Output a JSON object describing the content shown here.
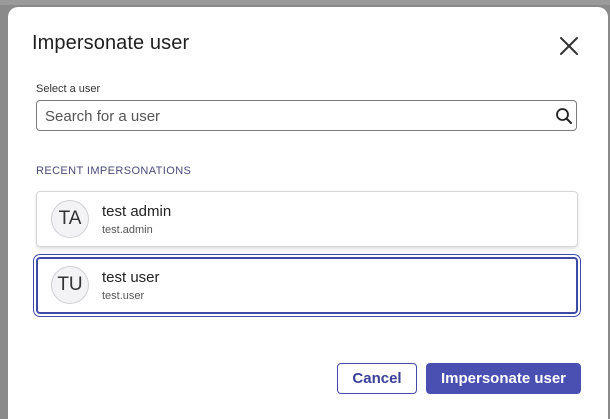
{
  "dialog": {
    "title": "Impersonate user",
    "close_icon": "close-icon"
  },
  "search": {
    "label": "Select a user",
    "placeholder": "Search for a user",
    "value": "",
    "icon": "search-icon"
  },
  "recent": {
    "heading": "RECENT IMPERSONATIONS",
    "users": [
      {
        "initials": "TA",
        "name": "test admin",
        "username": "test.admin",
        "selected": false
      },
      {
        "initials": "TU",
        "name": "test user",
        "username": "test.user",
        "selected": true
      }
    ]
  },
  "actions": {
    "cancel_label": "Cancel",
    "confirm_label": "Impersonate user"
  },
  "colors": {
    "accent": "#4a4fb2",
    "selected_border": "#3f4aa6",
    "overlay": "#8a8a8a"
  }
}
